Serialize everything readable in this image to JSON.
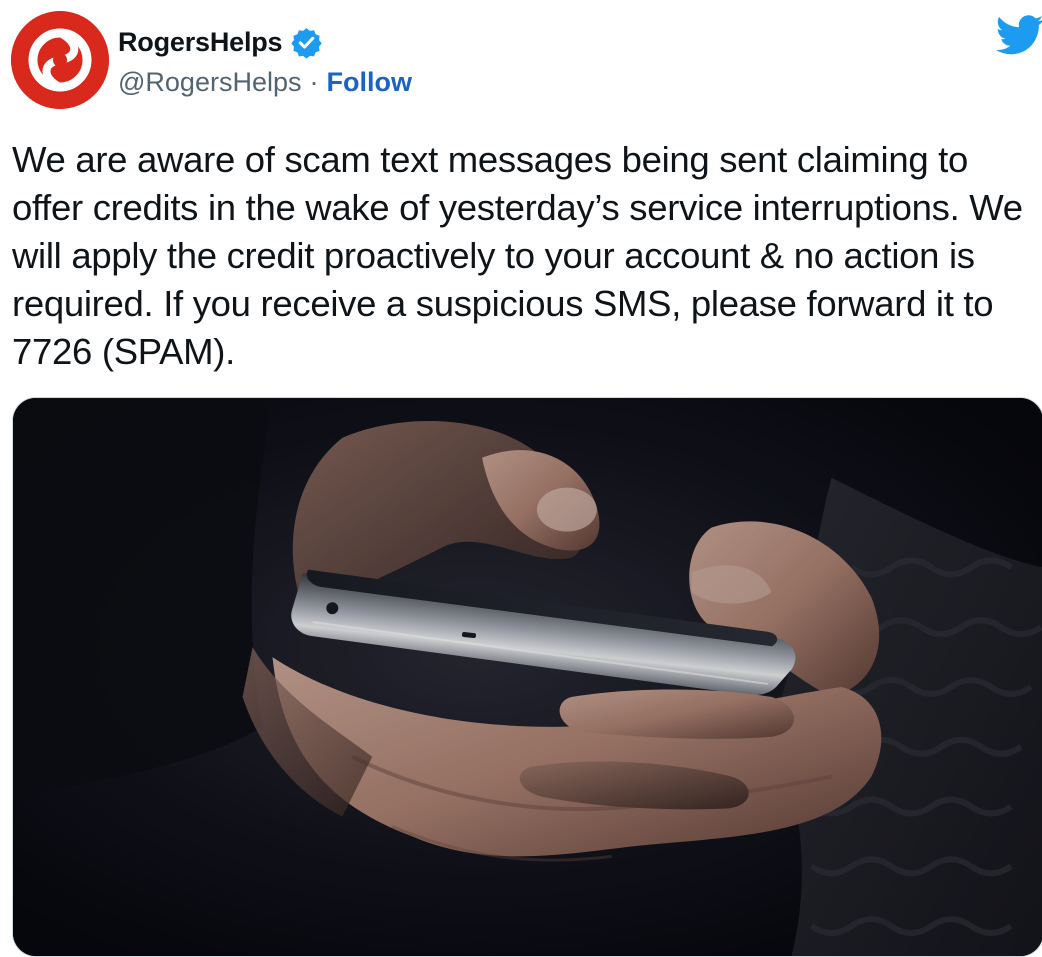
{
  "account": {
    "display_name": "RogersHelps",
    "handle": "@RogersHelps",
    "separator": "·",
    "follow_label": "Follow",
    "verified": true,
    "avatar_icon": "rogers-logo-icon"
  },
  "tweet": {
    "text": "We are aware of scam text messages being sent claiming to offer credits in the wake of yesterday’s service interruptions. We will apply the credit proactively to your account & no action is required. If you receive a suspicious SMS, please forward it to 7726 (SPAM)."
  },
  "media": {
    "icon": "photo-hands-holding-smartphone"
  },
  "platform_icon": "twitter-bird-icon",
  "colors": {
    "brand_red": "#d9281c",
    "twitter_blue": "#1d9bf0",
    "follow_blue": "#1d63c4",
    "muted": "#536471"
  }
}
